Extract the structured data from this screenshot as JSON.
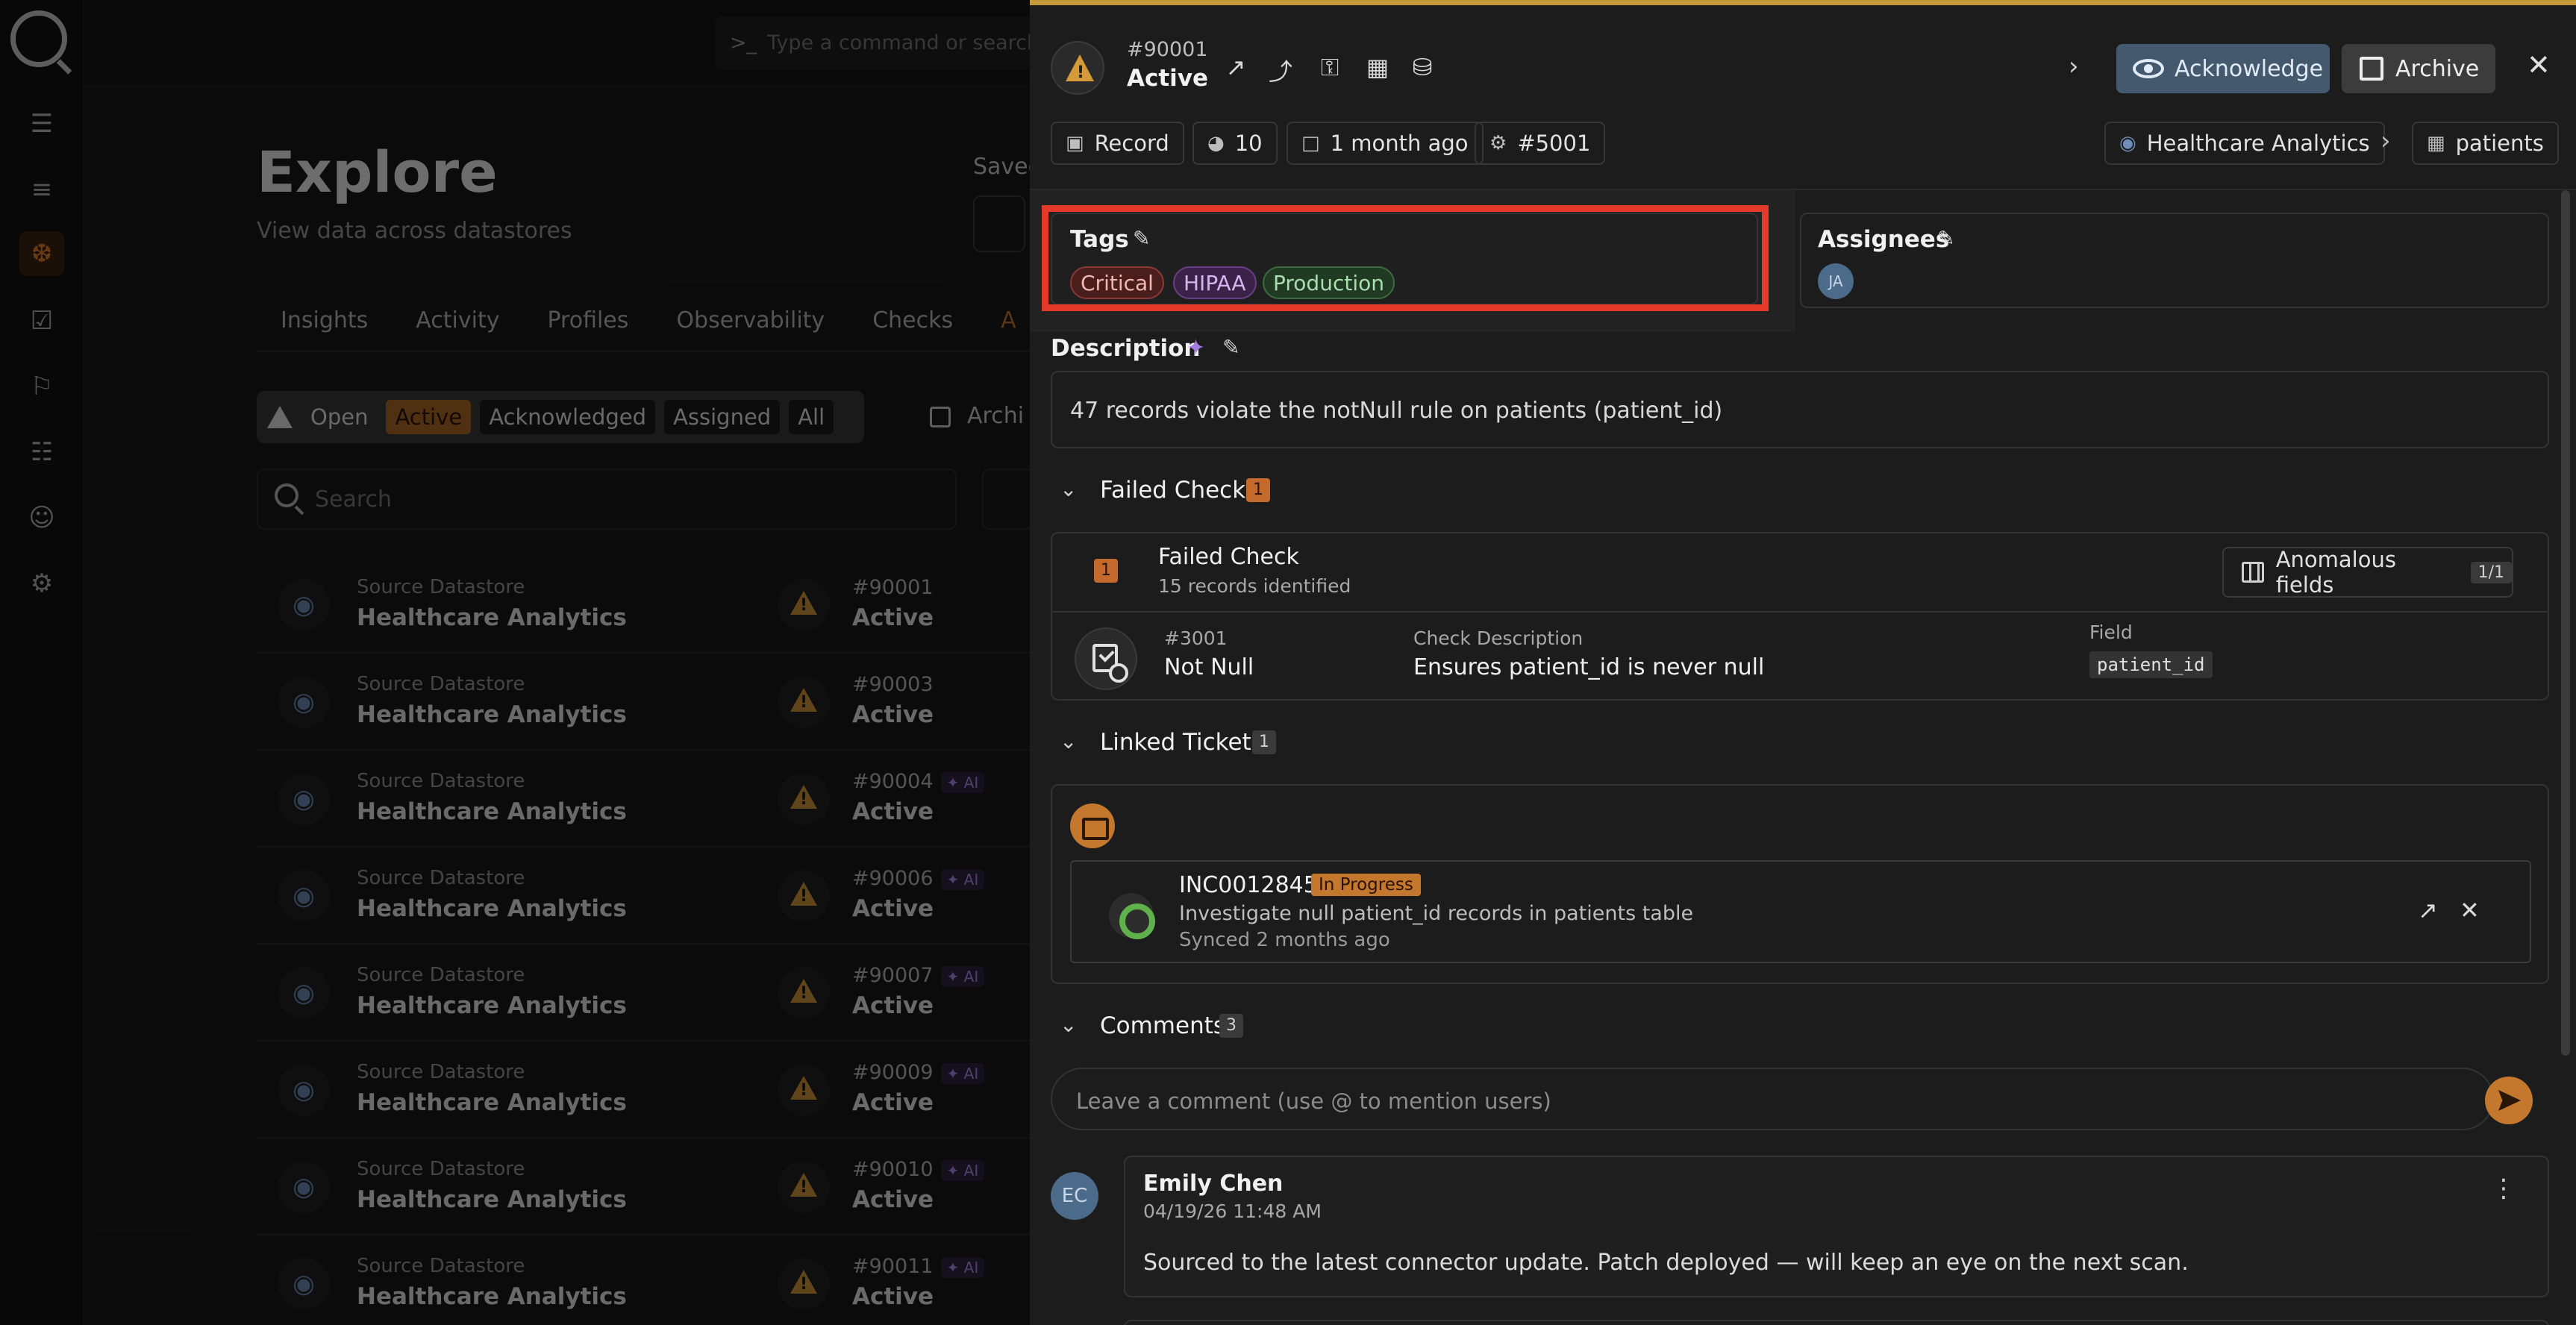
{
  "background": {
    "command_placeholder": "Type a command or search...",
    "command_prompt": ">_",
    "page_title": "Explore",
    "page_subtitle": "View data across datastores",
    "saved_label": "Saved",
    "tabs": [
      "Insights",
      "Activity",
      "Profiles",
      "Observability",
      "Checks",
      "A"
    ],
    "status_filters": [
      "Open",
      "Active",
      "Acknowledged",
      "Assigned",
      "All"
    ],
    "archived_label": "Archi",
    "search_placeholder": "Search",
    "rows": [
      {
        "label": "Source Datastore",
        "name": "Healthcare Analytics",
        "id": "#90001",
        "ai": "",
        "status": "Active"
      },
      {
        "label": "Source Datastore",
        "name": "Healthcare Analytics",
        "id": "#90003",
        "ai": "",
        "status": "Active"
      },
      {
        "label": "Source Datastore",
        "name": "Healthcare Analytics",
        "id": "#90004",
        "ai": "AI",
        "status": "Active"
      },
      {
        "label": "Source Datastore",
        "name": "Healthcare Analytics",
        "id": "#90006",
        "ai": "AI",
        "status": "Active"
      },
      {
        "label": "Source Datastore",
        "name": "Healthcare Analytics",
        "id": "#90007",
        "ai": "AI",
        "status": "Active"
      },
      {
        "label": "Source Datastore",
        "name": "Healthcare Analytics",
        "id": "#90009",
        "ai": "AI",
        "status": "Active"
      },
      {
        "label": "Source Datastore",
        "name": "Healthcare Analytics",
        "id": "#90010",
        "ai": "AI",
        "status": "Active"
      },
      {
        "label": "Source Datastore",
        "name": "Healthcare Analytics",
        "id": "#90011",
        "ai": "AI",
        "status": "Active"
      }
    ]
  },
  "drawer": {
    "anomaly_id": "#90001",
    "status": "Active",
    "acknowledge_label": "Acknowledge",
    "archive_label": "Archive",
    "meta": {
      "type": "Record",
      "weight": "10",
      "age": "1 month ago",
      "check_ref": "#5001",
      "datastore": "Healthcare Analytics",
      "container": "patients"
    },
    "tags": {
      "label": "Tags",
      "items": [
        "Critical",
        "HIPAA",
        "Production"
      ]
    },
    "assignees": {
      "label": "Assignees",
      "initials": "JA"
    },
    "description": {
      "label": "Description",
      "text": "47 records violate the notNull rule on patients (patient_id)"
    },
    "failed_checks": {
      "label": "Failed Checks",
      "count": "1",
      "card_count": "1",
      "title": "Failed Check",
      "subtitle": "15 records identified",
      "anomalous_fields_label": "Anomalous fields",
      "anomalous_fields_frac": "1/1",
      "check_id": "#3001",
      "check_rule": "Not Null",
      "desc_label": "Check Description",
      "desc_value": "Ensures patient_id is never null",
      "field_label": "Field",
      "field_value": "patient_id"
    },
    "linked_tickets": {
      "label": "Linked Tickets",
      "count": "1",
      "ticket_id": "INC0012845",
      "ticket_status": "In Progress",
      "ticket_desc": "Investigate null patient_id records in patients table",
      "ticket_sync": "Synced 2 months ago"
    },
    "comments": {
      "label": "Comments",
      "count": "3",
      "placeholder": "Leave a comment (use @ to mention users)",
      "items": [
        {
          "initials": "EC",
          "author": "Emily Chen",
          "date": "04/19/26 11:48 AM",
          "text": "Sourced to the latest connector update. Patch deployed — will keep an eye on the next scan."
        }
      ]
    }
  },
  "colors": {
    "accent": "#c4782e",
    "highlight": "#e53a2a",
    "warning": "#d49a3a"
  }
}
